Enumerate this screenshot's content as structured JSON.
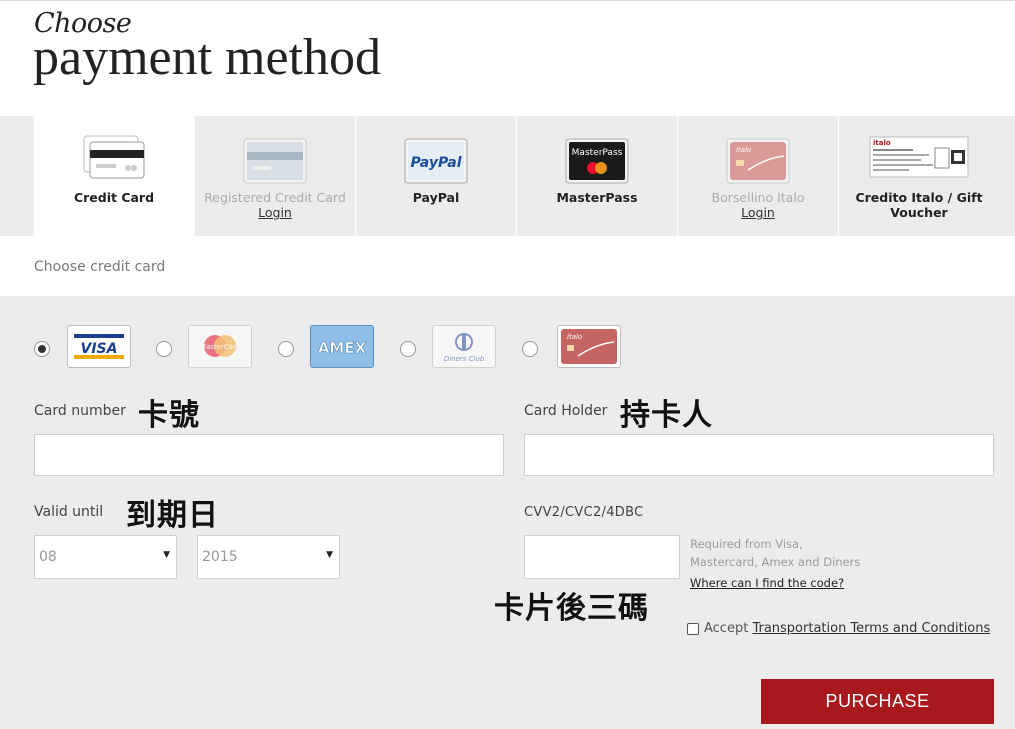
{
  "header": {
    "title_small": "Choose",
    "title_big": "payment method"
  },
  "tabs": [
    {
      "label": "Credit Card",
      "login": "",
      "icon": "credit-card-icon",
      "active": true
    },
    {
      "label": "Registered Credit Card",
      "login": "Login",
      "icon": "registered-card-icon",
      "active": false
    },
    {
      "label": "PayPal",
      "login": "",
      "icon": "paypal-logo",
      "active": false
    },
    {
      "label": "MasterPass",
      "login": "",
      "icon": "masterpass-logo",
      "active": false
    },
    {
      "label": "Borsellino Italo",
      "login": "Login",
      "icon": "italo-card-icon",
      "active": false
    },
    {
      "label": "Credito Italo / Gift",
      "label2": "Voucher",
      "login": "",
      "icon": "voucher-icon",
      "active": false
    }
  ],
  "logos": {
    "paypal": "PayPal",
    "masterpass": "MasterPass",
    "visa": "VISA",
    "mastercard": "MasterCard",
    "amex": "AMEX",
    "diners": "Diners Club",
    "italo": "italo",
    "voucher_brand": "italo"
  },
  "choose_card": "Choose credit card",
  "form": {
    "card_number_label": "Card number",
    "card_number_note": "卡號",
    "card_holder_label": "Card Holder",
    "card_holder_note": "持卡人",
    "valid_until_label": "Valid until",
    "valid_until_note": "到期日",
    "month_value": "08",
    "year_value": "2015",
    "cvv_label": "CVV2/CVC2/4DBC",
    "cvv_help_1": "Required from Visa,",
    "cvv_help_2": "Mastercard, Amex and Diners",
    "cvv_link": "Where can I find the code?",
    "cvv_note": "卡片後三碼",
    "accept_label": "Accept",
    "accept_link": "Transportation Terms and Conditions",
    "purchase_label": "PURCHASE"
  },
  "colors": {
    "accent": "#a8191d",
    "panel": "#ececec"
  }
}
